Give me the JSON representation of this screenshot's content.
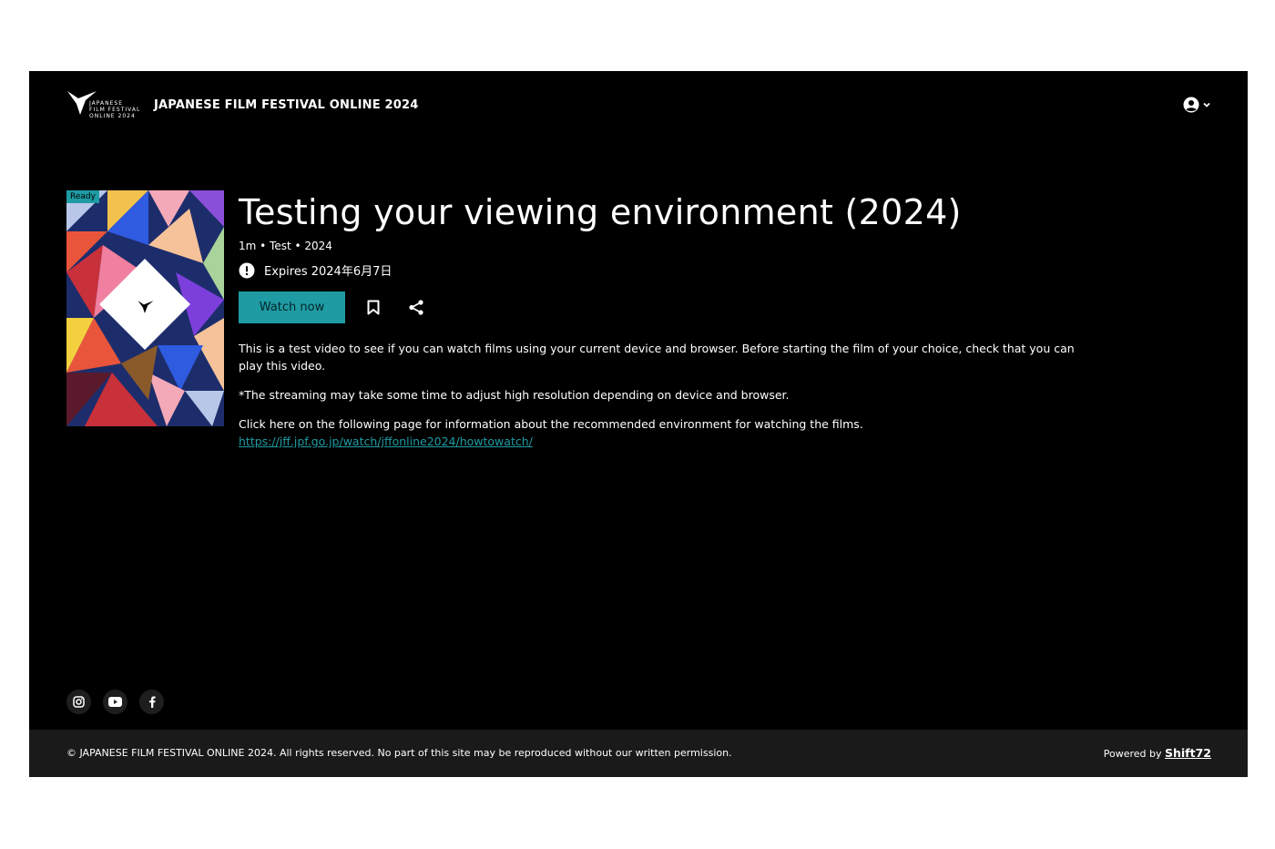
{
  "header": {
    "logo_lines": "JAPANESE\nFILM FESTIVAL\nONLINE 2024",
    "site_title": "JAPANESE FILM FESTIVAL ONLINE 2024",
    "account_icon": "user-circle-icon",
    "account_chevron_icon": "chevron-down-icon"
  },
  "poster": {
    "badge": "Ready",
    "logo_lines": "JAPANESE\nFILM FESTIVAL\nONLINE 2024"
  },
  "film": {
    "title": "Testing your viewing environment (2024)",
    "meta": "1m • Test • 2024",
    "expires": "Expires 2024年6月7日",
    "watch_label": "Watch now",
    "bookmark_icon": "bookmark-icon",
    "share_icon": "share-icon"
  },
  "description": {
    "p1": "This is a test video to see if you can watch films using your current device and browser. Before starting the film of your choice, check that you can play this video.",
    "p2": "*The streaming may take some time to adjust high resolution depending on device and browser.",
    "p3": "Click here on the following page for information about the recommended environment for watching the films.",
    "link": "https://jff.jpf.go.jp/watch/jffonline2024/howtowatch/"
  },
  "social": [
    "instagram-icon",
    "youtube-icon",
    "facebook-icon"
  ],
  "footer": {
    "copyright": "© JAPANESE FILM FESTIVAL ONLINE 2024. All rights reserved. No part of this site may be reproduced without our written permission.",
    "powered_prefix": "Powered by",
    "powered_link": "Shift72"
  },
  "colors": {
    "accent": "#1f9ba3",
    "background": "#000000",
    "footer_bg": "#1a1a1a"
  }
}
